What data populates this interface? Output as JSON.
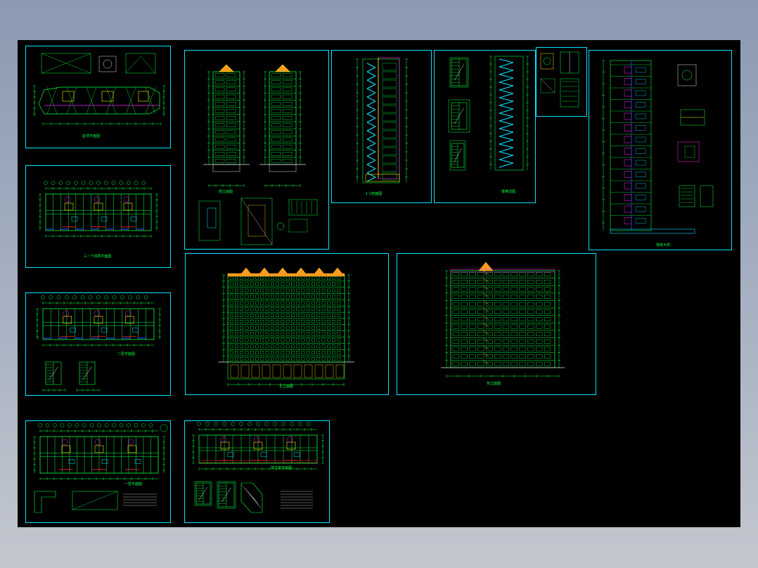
{
  "app": {
    "viewport": "cad-drawing-canvas"
  },
  "colors": {
    "frame": "#00e5ff",
    "line": "#00ff40",
    "accent_yellow": "#ffe800",
    "accent_magenta": "#ff20ff",
    "accent_red": "#ff2020",
    "accent_blue": "#3040ff",
    "accent_cyan": "#00e5ff",
    "accent_white": "#e0e0e0",
    "accent_orange": "#ff9a20"
  },
  "sheets": [
    {
      "id": "roof-plan",
      "title": "屋顶平面图",
      "kind": "plan"
    },
    {
      "id": "typical-floor-plan",
      "title": "三~十四层平面图",
      "kind": "plan"
    },
    {
      "id": "second-floor-plan",
      "title": "二层平面图",
      "kind": "plan-stair"
    },
    {
      "id": "ground-floor-plan",
      "title": "一层平面图",
      "kind": "plan-detail"
    },
    {
      "id": "side-elevations",
      "title": "侧立面图",
      "kind": "side-elev"
    },
    {
      "id": "stair-section-1",
      "title": "1-1剖面图",
      "kind": "section-stair"
    },
    {
      "id": "stair-details",
      "title": "楼梯详图",
      "kind": "stair-detail"
    },
    {
      "id": "small-details",
      "title": "",
      "kind": "small"
    },
    {
      "id": "wall-section",
      "title": "墙身大样",
      "kind": "wall-section"
    },
    {
      "id": "front-elevation",
      "title": "正立面图",
      "kind": "front-elev"
    },
    {
      "id": "rear-elevation",
      "title": "背立面图",
      "kind": "rear-elev"
    },
    {
      "id": "basement-plan",
      "title": "地下室平面图",
      "kind": "plan-basement"
    }
  ]
}
